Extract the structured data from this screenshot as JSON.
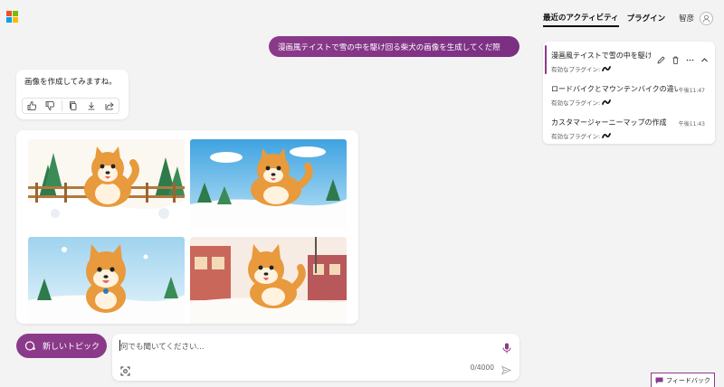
{
  "brand": {
    "colors": [
      "#f25022",
      "#7fba00",
      "#00a4ef",
      "#ffb900"
    ],
    "accent": "#8b3a8a"
  },
  "chat": {
    "user_message": "漫画風テイストで雪の中を駆け回る柴犬の画像を生成してくだ際",
    "bot_message": "画像を作成してみますね。",
    "bot_actions": [
      "thumbs-up-icon",
      "thumbs-down-icon",
      "copy-icon",
      "download-icon",
      "share-icon"
    ],
    "images": [
      {
        "name": "shiba-fence-snow"
      },
      {
        "name": "shiba-blue-sky"
      },
      {
        "name": "shiba-snowball"
      },
      {
        "name": "shiba-town"
      }
    ]
  },
  "new_topic": {
    "label": "新しいトピック",
    "icon": "new-topic-icon"
  },
  "input": {
    "placeholder": "何でも聞いてください...",
    "counter": "0/4000"
  },
  "nav": {
    "activity_tab": "最近のアクティビティ",
    "plugin_tab": "プラグイン",
    "user_name": "智彦"
  },
  "conversations": [
    {
      "title": "漫画風テイストで雪の中を駆け回る",
      "sub": "有効なプラグイン:",
      "time": ""
    },
    {
      "title": "ロードバイクとマウンテンバイクの違い",
      "sub": "有効なプラグイン:",
      "time": "午後11:47"
    },
    {
      "title": "カスタマージャーニーマップの作成",
      "sub": "有効なプラグイン:",
      "time": "午後11:43"
    }
  ],
  "feedback": {
    "label": "フィードバック"
  }
}
